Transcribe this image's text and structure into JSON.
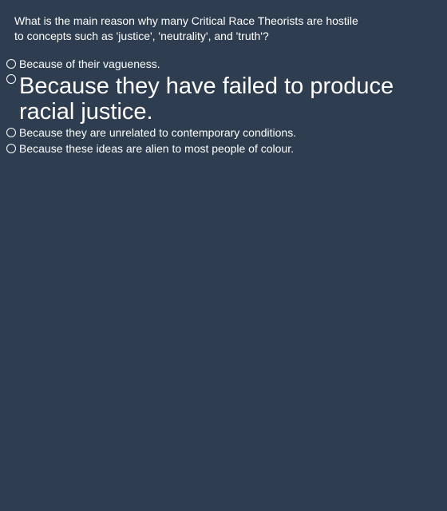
{
  "question": {
    "line1": "What is the main reason why many Critical Race Theorists are hostile",
    "line2": "to concepts such as 'justice', 'neutrality', and 'truth'?"
  },
  "options": [
    {
      "label": "Because of their vagueness.",
      "selected": false
    },
    {
      "label": "Because they have failed to produce racial justice.",
      "selected": false
    },
    {
      "label": "Because they are unrelated to contemporary conditions.",
      "selected": false
    },
    {
      "label": "Because these ideas are alien to most people of colour.",
      "selected": false
    }
  ],
  "colors": {
    "background": "#2e3d4f",
    "text": "#ffffff"
  }
}
